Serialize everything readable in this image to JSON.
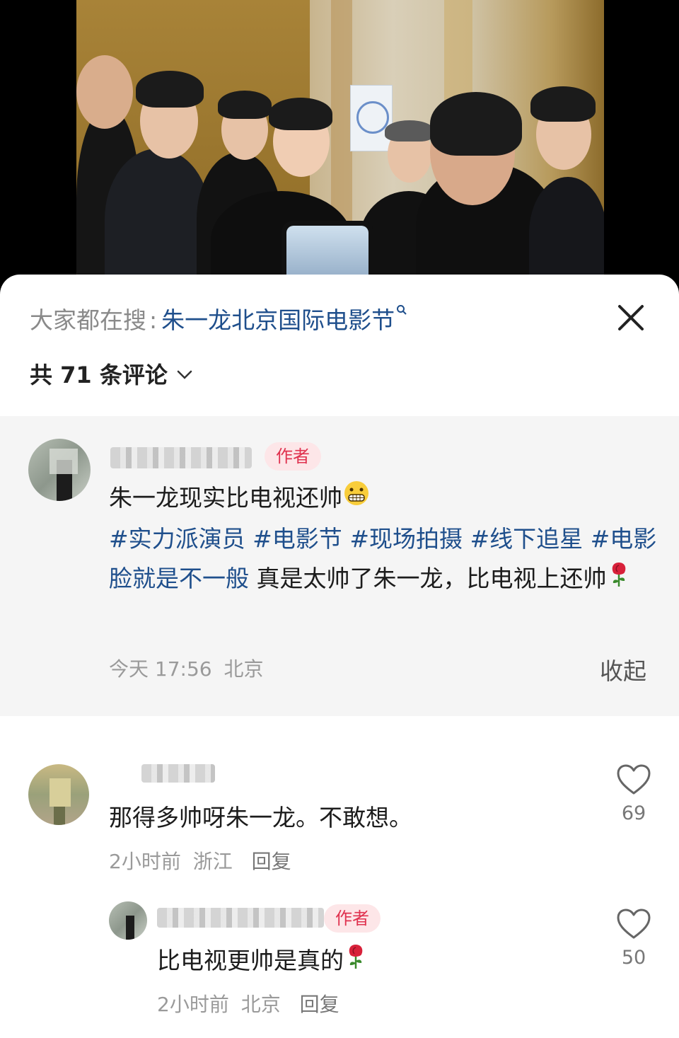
{
  "search": {
    "prefix": "大家都在搜",
    "colon": ":",
    "term": "朱一龙北京国际电影节",
    "term_icon": "search-icon"
  },
  "comments_header": {
    "count_label": "共 71 条评论",
    "chevron": "chevron-down-icon"
  },
  "pinned_comment": {
    "author_tag": "作者",
    "text_main": "朱一龙现实比电视还帅",
    "emoji_1": "grimace-emoji",
    "hashtags": [
      "#实力派演员",
      "#电影节",
      "#现场拍摄",
      "#线下追星",
      "#电影脸就是不一般"
    ],
    "text_tail": "真是太帅了朱一龙，比电视上还帅",
    "emoji_2": "rose-emoji",
    "time": "今天 17:56",
    "location": "北京",
    "collapse_label": "收起"
  },
  "comments": [
    {
      "text": "那得多帅呀朱一龙。不敢想。",
      "time": "2小时前",
      "location": "浙江",
      "reply_label": "回复",
      "likes": "69"
    }
  ],
  "replies": [
    {
      "author_tag": "作者",
      "text": "比电视更帅是真的",
      "emoji": "rose-emoji",
      "time": "2小时前",
      "location": "北京",
      "reply_label": "回复",
      "likes": "50"
    }
  ],
  "colors": {
    "hashtag": "#1f4f8c",
    "author_tag_bg": "#fde6e8",
    "author_tag_text": "#e0324f",
    "pinned_bg": "#f5f5f5"
  }
}
